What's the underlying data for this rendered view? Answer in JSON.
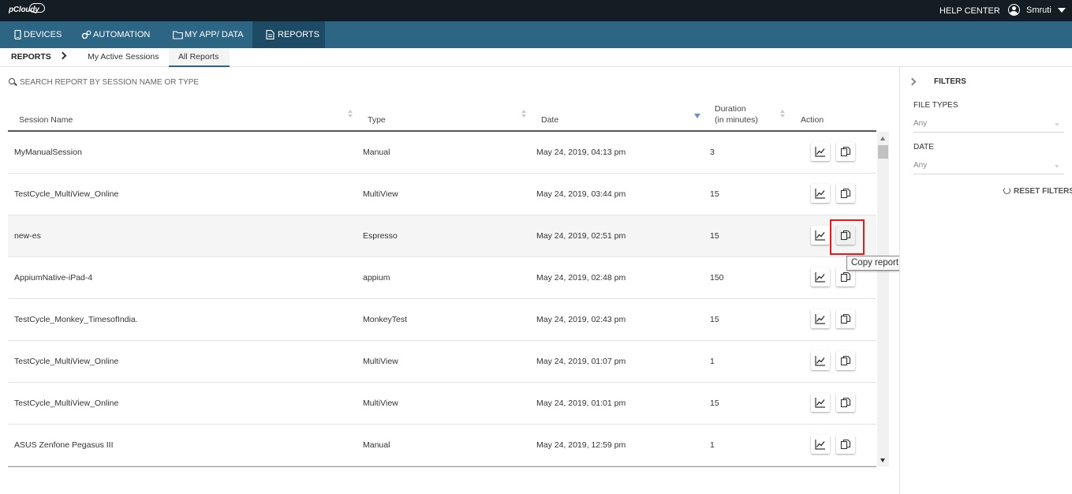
{
  "brand": {
    "logo_text": "pCloudy"
  },
  "topbar": {
    "help_label": "HELP CENTER",
    "username": "Smruti"
  },
  "nav": {
    "items": [
      {
        "label": "DEVICES",
        "icon": "device-icon"
      },
      {
        "label": "AUTOMATION",
        "icon": "gears-icon"
      },
      {
        "label": "MY APP/ DATA",
        "icon": "folder-icon"
      },
      {
        "label": "REPORTS",
        "icon": "document-icon",
        "active": true
      }
    ]
  },
  "subnav": {
    "crumb": "REPORTS",
    "tabs": [
      {
        "label": "My Active Sessions",
        "active": false
      },
      {
        "label": "All Reports",
        "active": true
      }
    ]
  },
  "search": {
    "placeholder": "SEARCH REPORT BY SESSION NAME OR TYPE",
    "value": ""
  },
  "table": {
    "headers": {
      "session_name": "Session Name",
      "type": "Type",
      "date": "Date",
      "duration_line1": "Duration",
      "duration_line2": "(in minutes)",
      "action": "Action"
    },
    "sort": {
      "column": "Date",
      "direction": "descending"
    },
    "rows": [
      {
        "name": "MyManualSession",
        "type": "Manual",
        "date": "May 24, 2019, 04:13 pm",
        "duration": "3"
      },
      {
        "name": "TestCycle_MultiView_Online",
        "type": "MultiView",
        "date": "May 24, 2019, 03:44 pm",
        "duration": "15"
      },
      {
        "name": "new-es",
        "type": "Espresso",
        "date": "May 24, 2019, 02:51 pm",
        "duration": "15",
        "highlighted": true
      },
      {
        "name": "AppiumNative-iPad-4",
        "type": "appium",
        "date": "May 24, 2019, 02:48 pm",
        "duration": "150"
      },
      {
        "name": "TestCycle_Monkey_TimesofIndia.",
        "type": "MonkeyTest",
        "date": "May 24, 2019, 02:43 pm",
        "duration": "15"
      },
      {
        "name": "TestCycle_MultiView_Online",
        "type": "MultiView",
        "date": "May 24, 2019, 01:07 pm",
        "duration": "1"
      },
      {
        "name": "TestCycle_MultiView_Online",
        "type": "MultiView",
        "date": "May 24, 2019, 01:01 pm",
        "duration": "15"
      },
      {
        "name": "ASUS Zenfone Pegasus III",
        "type": "Manual",
        "date": "May 24, 2019, 12:59 pm",
        "duration": "1"
      }
    ]
  },
  "tooltip": {
    "text": "Copy report link for sharing"
  },
  "filters": {
    "title": "FILTERS",
    "file_types_label": "FILE TYPES",
    "file_types_value": "Any",
    "date_label": "DATE",
    "date_value": "Any",
    "reset_label": "RESET FILTERS"
  },
  "colors": {
    "topbar": "#141c24",
    "navbar": "#2d6584",
    "nav_active": "#1d4b66",
    "highlight_border": "#e21b1b",
    "sort_active": "#6a8fd3"
  }
}
